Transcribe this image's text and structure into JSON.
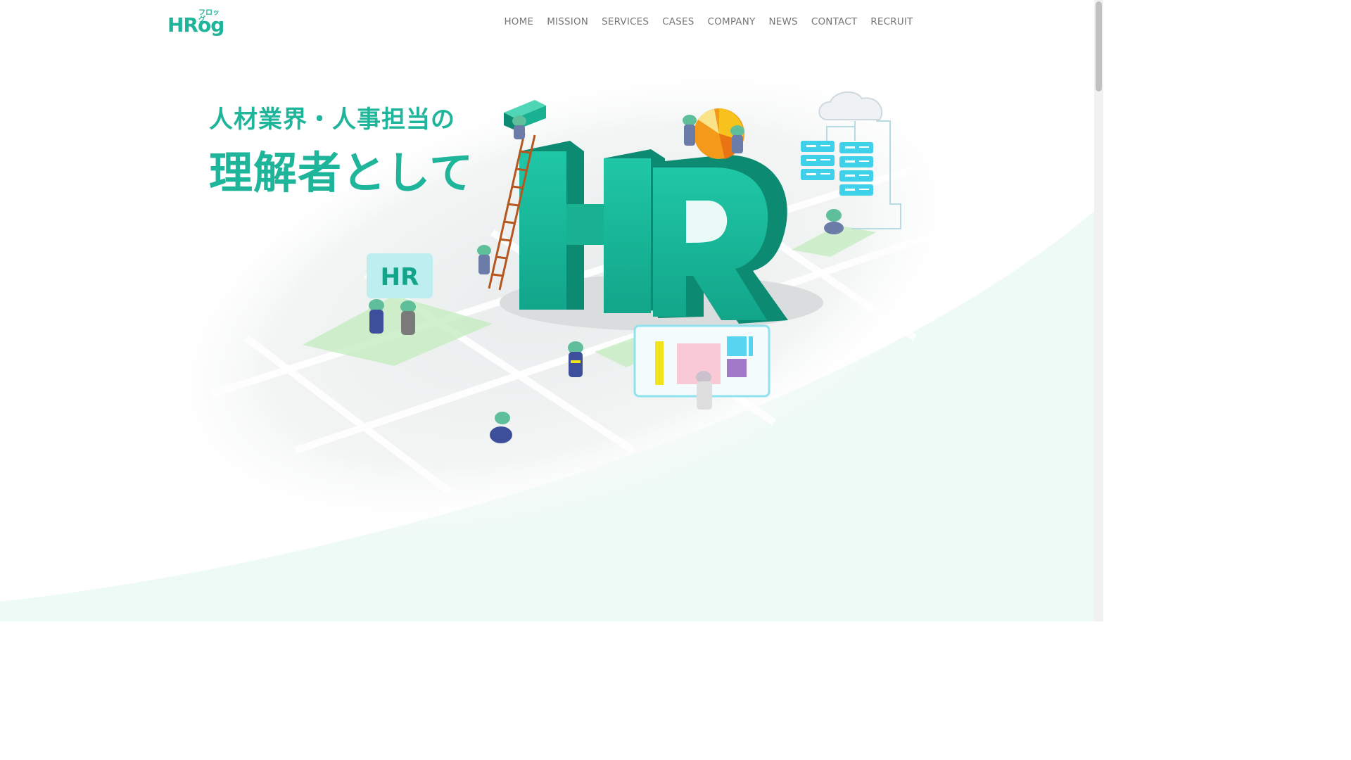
{
  "header": {
    "logo_text": "HRog",
    "logo_sub": "フロッグ",
    "nav": [
      {
        "label": "HOME"
      },
      {
        "label": "MISSION"
      },
      {
        "label": "SERVICES"
      },
      {
        "label": "CASES"
      },
      {
        "label": "COMPANY"
      },
      {
        "label": "NEWS"
      },
      {
        "label": "CONTACT"
      },
      {
        "label": "RECRUIT"
      }
    ]
  },
  "hero": {
    "headline_line1": "人材業界・人事担当の",
    "headline_line2": "理解者として",
    "illustration_text": "HR",
    "sign_text": "HR"
  },
  "colors": {
    "brand": "#1fb59a",
    "brand_dark": "#0f8f78",
    "nav_text": "#777777",
    "bg_wave": "#eefaf5"
  },
  "icons": [
    "frog-character-icon",
    "server-stack-icon",
    "cloud-icon",
    "pie-chart-icon",
    "ladder-icon",
    "dashboard-panel-icon"
  ]
}
